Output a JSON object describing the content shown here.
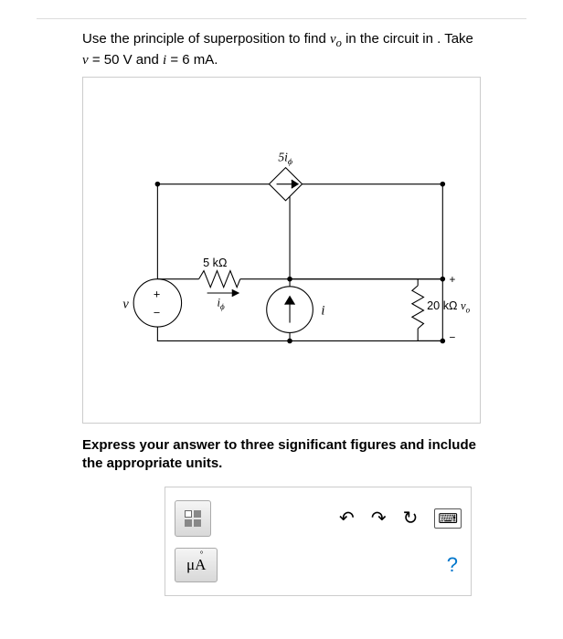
{
  "problem": {
    "line1_pre": "Use the principle of superposition to find ",
    "v_o": "v",
    "v_o_sub": "o",
    "line1_post": " in the circuit in . Take ",
    "v_eq": "v",
    "eq1": " = 50 V and ",
    "i_eq": "i",
    "eq2": " = 6 mA."
  },
  "circuit": {
    "top_source_label": "5i",
    "top_source_sub": "ϕ",
    "r1_label": "5 kΩ",
    "i_phi": "i",
    "i_phi_sub": "ϕ",
    "v_src": "v",
    "i_src": "i",
    "r2_label": "20 kΩ",
    "vo": "v",
    "vo_sub": "o"
  },
  "sigfigs": "Express your answer to three significant figures and include the appropriate units.",
  "answer": {
    "units_mu": "μ",
    "units_A": "A"
  }
}
